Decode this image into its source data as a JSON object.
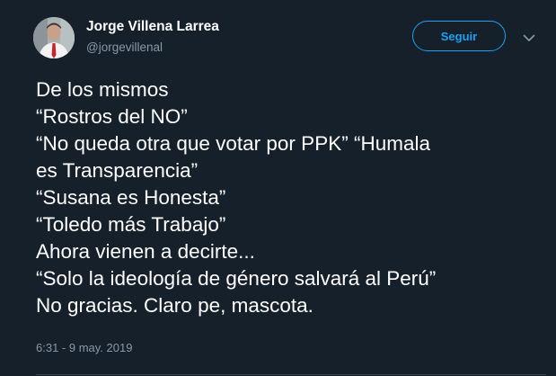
{
  "author": {
    "display_name": "Jorge Villena Larrea",
    "handle": "@jorgevillenal",
    "avatar_icon": "person-photo-avatar"
  },
  "actions": {
    "follow_label": "Seguir",
    "more_icon": "chevron-down-icon"
  },
  "tweet": {
    "lines": [
      "De los mismos",
      "“Rostros del NO”",
      "“No queda otra que votar por PPK” “Humala",
      "es Transparencia”",
      "“Susana es Honesta”",
      "“Toledo más Trabajo”",
      "Ahora vienen a decirte...",
      "“Solo la ideología de género salvará al Perú”",
      "No gracias. Claro pe, mascota."
    ],
    "timestamp": "6:31 - 9 may. 2019"
  },
  "colors": {
    "background": "#15202b",
    "accent": "#1da1f2",
    "text_primary": "#ffffff",
    "text_secondary": "#8899a6"
  }
}
